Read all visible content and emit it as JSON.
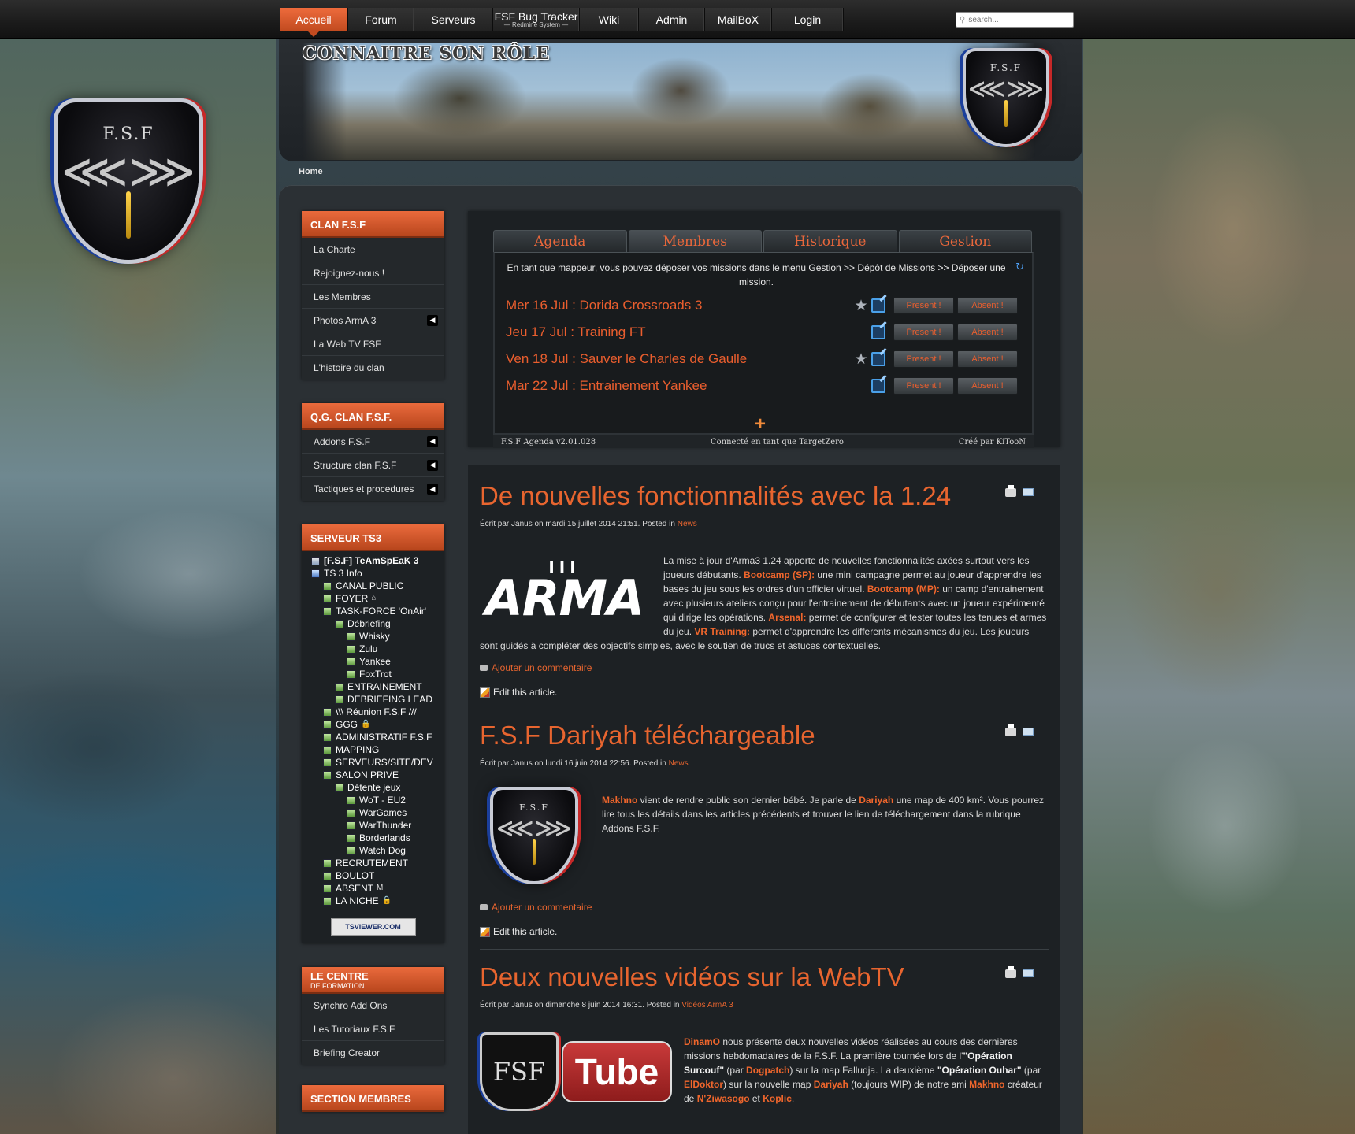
{
  "nav": {
    "items": [
      {
        "label": "Accueil",
        "active": true
      },
      {
        "label": "Forum"
      },
      {
        "label": "Serveurs"
      },
      {
        "label": "FSF Bug Tracker",
        "sub": "— Redmine System —"
      },
      {
        "label": "Wiki"
      },
      {
        "label": "Admin"
      },
      {
        "label": "MailBoX"
      },
      {
        "label": "Login"
      }
    ],
    "search_placeholder": "search..."
  },
  "header": {
    "banner_title": "CONNAITRE SON RÔLE",
    "crest_text": "F.S.F"
  },
  "breadcrumb": "Home",
  "sidebar": {
    "clan": {
      "title": "CLAN F.S.F",
      "items": [
        "La Charte",
        "Rejoignez-nous !",
        "Les Membres",
        "Photos ArmA 3",
        "La Web TV FSF",
        "L'histoire du clan"
      ]
    },
    "qg": {
      "title": "Q.G. CLAN F.S.F.",
      "items": [
        "Addons F.S.F",
        "Structure clan F.S.F",
        "Tactiques et procedures"
      ]
    },
    "ts3": {
      "title": "SERVEUR TS3",
      "rows": [
        {
          "label": "[F.S.F] TeAmSpEaK 3",
          "level": 0,
          "type": "srv",
          "bold": true
        },
        {
          "label": "TS 3 Info",
          "level": 0,
          "type": "info"
        },
        {
          "label": "CANAL PUBLIC",
          "level": 1
        },
        {
          "label": "FOYER",
          "level": 1,
          "suffix": "⌂"
        },
        {
          "label": "TASK-FORCE 'OnAir'",
          "level": 1
        },
        {
          "label": "Débriefing",
          "level": 2
        },
        {
          "label": "Whisky",
          "level": 3
        },
        {
          "label": "Zulu",
          "level": 3
        },
        {
          "label": "Yankee",
          "level": 3
        },
        {
          "label": "FoxTrot",
          "level": 3
        },
        {
          "label": "ENTRAINEMENT",
          "level": 2
        },
        {
          "label": "DEBRIEFING LEAD",
          "level": 2
        },
        {
          "label": "\\\\\\ Réunion F.S.F ///",
          "level": 1
        },
        {
          "label": "GGG",
          "level": 1,
          "suffix": "🔒"
        },
        {
          "label": "ADMINISTRATIF F.S.F",
          "level": 1
        },
        {
          "label": "MAPPING",
          "level": 1
        },
        {
          "label": "SERVEURS/SITE/DEV",
          "level": 1
        },
        {
          "label": "SALON PRIVE",
          "level": 1
        },
        {
          "label": "Détente jeux",
          "level": 2
        },
        {
          "label": "WoT - EU2",
          "level": 3
        },
        {
          "label": "WarGames",
          "level": 3
        },
        {
          "label": "WarThunder",
          "level": 3
        },
        {
          "label": "Borderlands",
          "level": 3
        },
        {
          "label": "Watch Dog",
          "level": 3
        },
        {
          "label": "RECRUTEMENT",
          "level": 1
        },
        {
          "label": "BOULOT",
          "level": 1
        },
        {
          "label": "ABSENT",
          "level": 1,
          "suffix": "M"
        },
        {
          "label": "LA NICHE",
          "level": 1,
          "suffix": "🔒"
        }
      ],
      "badge": "TSVIEWER.COM"
    },
    "centre": {
      "title": "LE CENTRE",
      "subtitle": "DE FORMATION",
      "items": [
        "Synchro Add Ons",
        "Les Tutoriaux F.S.F",
        "Briefing Creator"
      ]
    },
    "membres": {
      "title": "SECTION MEMBRES"
    }
  },
  "agenda": {
    "tabs": [
      "Agenda",
      "Membres",
      "Historique",
      "Gestion"
    ],
    "active_tab": 1,
    "message": "En tant que mappeur, vous pouvez déposer vos missions dans le menu Gestion >> Dépôt de Missions >> Déposer une mission.",
    "events": [
      {
        "title": "Mer 16 Jul : Dorida Crossroads 3",
        "starred": true
      },
      {
        "title": "Jeu 17 Jul : Training FT",
        "starred": false
      },
      {
        "title": "Ven 18 Jul : Sauver le Charles de Gaulle",
        "starred": true
      },
      {
        "title": "Mar 22 Jul : Entrainement Yankee",
        "starred": false
      }
    ],
    "present_label": "Present !",
    "absent_label": "Absent !",
    "footer": {
      "version": "F.S.F Agenda v2.01.028",
      "connected": "Connecté en tant que TargetZero",
      "credit": "Créé par KiTooN"
    }
  },
  "articles": [
    {
      "title": "De nouvelles fonctionnalités avec la 1.24",
      "meta": "Écrit par Janus on mardi 15 juillet 2014 21:51. Posted in",
      "category": "News",
      "image": "ARMA III",
      "body": [
        {
          "t": "La mise à jour d'Arma3 1.24 apporte de nouvelles fonctionnalités axées surtout vers les joueurs débutants. "
        },
        {
          "t": "Bootcamp (SP):",
          "hl": true
        },
        {
          "t": " une mini campagne permet au joueur d'apprendre les bases du jeu sous les ordres d'un officier virtuel. "
        },
        {
          "t": "Bootcamp (MP):",
          "hl": true
        },
        {
          "t": " un camp d'entrainement avec plusieurs ateliers conçu pour l'entrainement de débutants  avec un joueur expérimenté qui dirige les opérations. "
        },
        {
          "t": "Arsenal:",
          "hl": true
        },
        {
          "t": " permet de configurer et tester toutes les tenues et armes du jeu. "
        },
        {
          "t": "VR Training:",
          "hl": true
        },
        {
          "t": " permet d'apprendre les differents mécanismes du jeu. Les joueurs sont guidés à compléter des objectifs simples, avec le soutien de trucs et astuces contextuelles."
        }
      ],
      "comment_link": "Ajouter un commentaire",
      "edit_label": "Edit this article."
    },
    {
      "title": "F.S.F Dariyah téléchargeable",
      "meta": "Écrit par Janus on lundi 16 juin 2014 22:56. Posted in",
      "category": "News",
      "image": "F.S.F",
      "body": [
        {
          "t": "Makhno",
          "hl": true
        },
        {
          "t": " vient de rendre public son dernier bébé. Je parle de "
        },
        {
          "t": "Dariyah",
          "hl": true
        },
        {
          "t": " une map de 400 km².  Vous pourrez lire tous les détails dans les articles précédents et trouver le lien de téléchargement dans la rubrique Addons F.S.F."
        }
      ],
      "comment_link": "Ajouter un commentaire",
      "edit_label": "Edit this article."
    },
    {
      "title": "Deux nouvelles vidéos sur la WebTV",
      "meta": "Écrit par Janus on dimanche 8 juin 2014 16:31. Posted in",
      "category": "Vidéos ArmA 3",
      "image_left": "FSF",
      "image_right": "Tube",
      "body": [
        {
          "t": "DinamO",
          "hl": true
        },
        {
          "t": " nous présente deux nouvelles vidéos réalisées au cours des dernières missions hebdomadaires de la F.S.F. La première tournée lors de l'"
        },
        {
          "t": "\"Opération Surcouf\"",
          "hl": true,
          "white": true
        },
        {
          "t": " (par "
        },
        {
          "t": "Dogpatch",
          "hl": true
        },
        {
          "t": ") sur la map Falludja. La deuxième "
        },
        {
          "t": "\"Opération Ouhar\"",
          "hl": true,
          "white": true
        },
        {
          "t": " (par "
        },
        {
          "t": "ElDoktor",
          "hl": true
        },
        {
          "t": ") sur la nouvelle map "
        },
        {
          "t": "Dariyah",
          "hl": true
        },
        {
          "t": " (toujours WIP) de notre ami "
        },
        {
          "t": "Makhno",
          "hl": true
        },
        {
          "t": " créateur de "
        },
        {
          "t": "N'Ziwasogo",
          "hl": true
        },
        {
          "t": " et "
        },
        {
          "t": "Koplic",
          "hl": true
        },
        {
          "t": "."
        }
      ]
    }
  ]
}
